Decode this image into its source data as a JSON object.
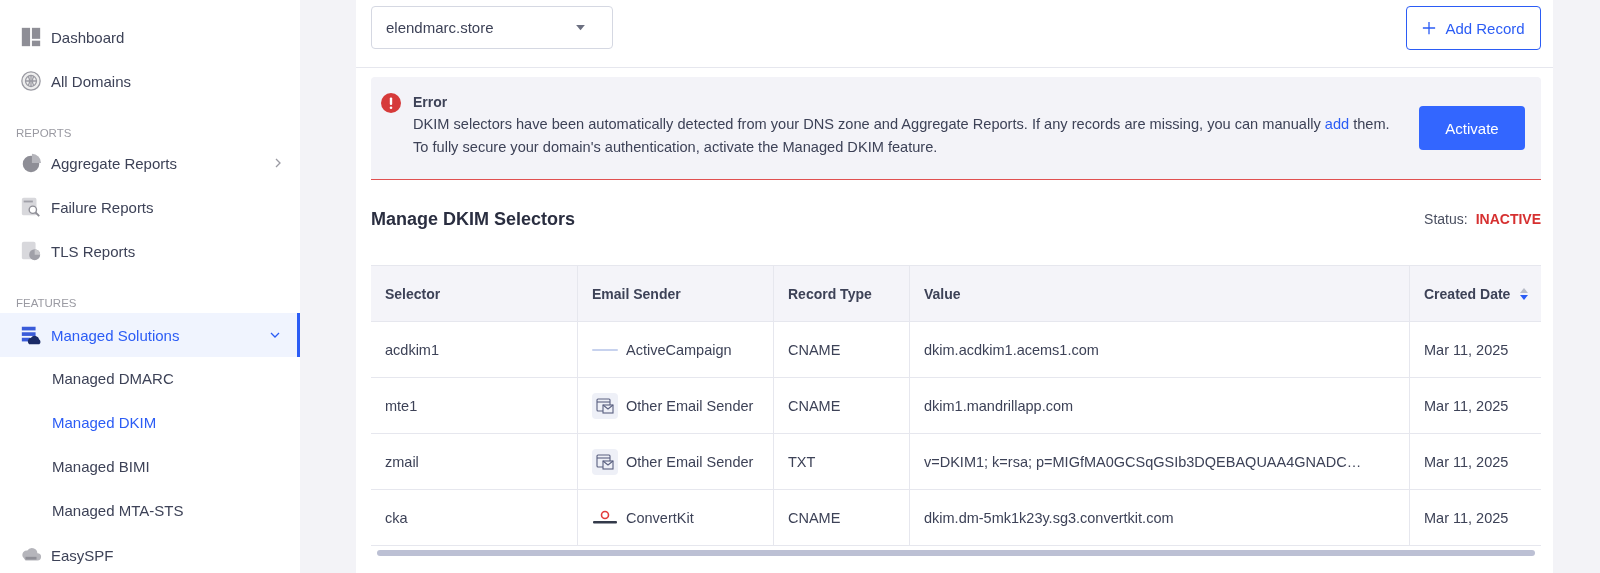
{
  "sidebar": {
    "items": [
      {
        "kind": "link",
        "label": "Dashboard",
        "selected": false
      },
      {
        "kind": "link",
        "label": "All Domains",
        "selected": false
      },
      {
        "kind": "section",
        "label": "REPORTS"
      },
      {
        "kind": "link",
        "label": "Aggregate Reports",
        "selected": false,
        "expanded": false
      },
      {
        "kind": "link",
        "label": "Failure Reports",
        "selected": false
      },
      {
        "kind": "link",
        "label": "TLS Reports",
        "selected": false
      },
      {
        "kind": "section",
        "label": "FEATURES"
      },
      {
        "kind": "link",
        "label": "Managed Solutions",
        "selected": true,
        "expanded": true,
        "children": [
          {
            "label": "Managed DMARC",
            "selected": false
          },
          {
            "label": "Managed DKIM",
            "selected": true
          },
          {
            "label": "Managed BIMI",
            "selected": false
          },
          {
            "label": "Managed MTA-STS",
            "selected": false
          }
        ]
      },
      {
        "kind": "link",
        "label": "EasySPF",
        "selected": false
      }
    ]
  },
  "toolbar": {
    "domain_select": {
      "value": "elendmarc.store"
    },
    "add_button": "Add Record"
  },
  "alert": {
    "title": "Error",
    "message_before": "DKIM selectors have been automatically detected from your DNS zone and Aggregate Reports. If any records are missing, you can manually ",
    "link": "add",
    "message_after": " them. To fully secure your domain's authentication, activate the Managed DKIM feature.",
    "button": "Activate"
  },
  "section": {
    "title": "Manage DKIM Selectors",
    "status_label": "Status:",
    "status": "INACTIVE"
  },
  "table": {
    "columns": [
      {
        "label": "Selector",
        "sortable": false
      },
      {
        "label": "Email Sender",
        "sortable": false
      },
      {
        "label": "Record Type",
        "sortable": false
      },
      {
        "label": "Value",
        "sortable": false
      },
      {
        "label": "Created Date",
        "sortable": true
      }
    ],
    "rows": [
      {
        "selector": "acdkim1",
        "sender": "ActiveCampaign",
        "kind": "logo",
        "type": "CNAME",
        "value": "dkim.acdkim1.acems1.com",
        "created": "Mar 11, 2025"
      },
      {
        "selector": "mte1",
        "sender": "Other Email Sender",
        "kind": "generic",
        "type": "CNAME",
        "value": "dkim1.mandrillapp.com",
        "created": "Mar 11, 2025"
      },
      {
        "selector": "zmail",
        "sender": "Other Email Sender",
        "kind": "generic",
        "type": "TXT",
        "value": "v=DKIM1; k=rsa; p=MIGfMA0GCSqGSIb3DQEBAQUAA4GNADC…",
        "created": "Mar 11, 2025"
      },
      {
        "selector": "cka",
        "sender": "ConvertKit",
        "kind": "logo",
        "type": "CNAME",
        "value": "dkim.dm-5mk1k23y.sg3.convertkit.com",
        "created": "Mar 11, 2025"
      }
    ]
  }
}
